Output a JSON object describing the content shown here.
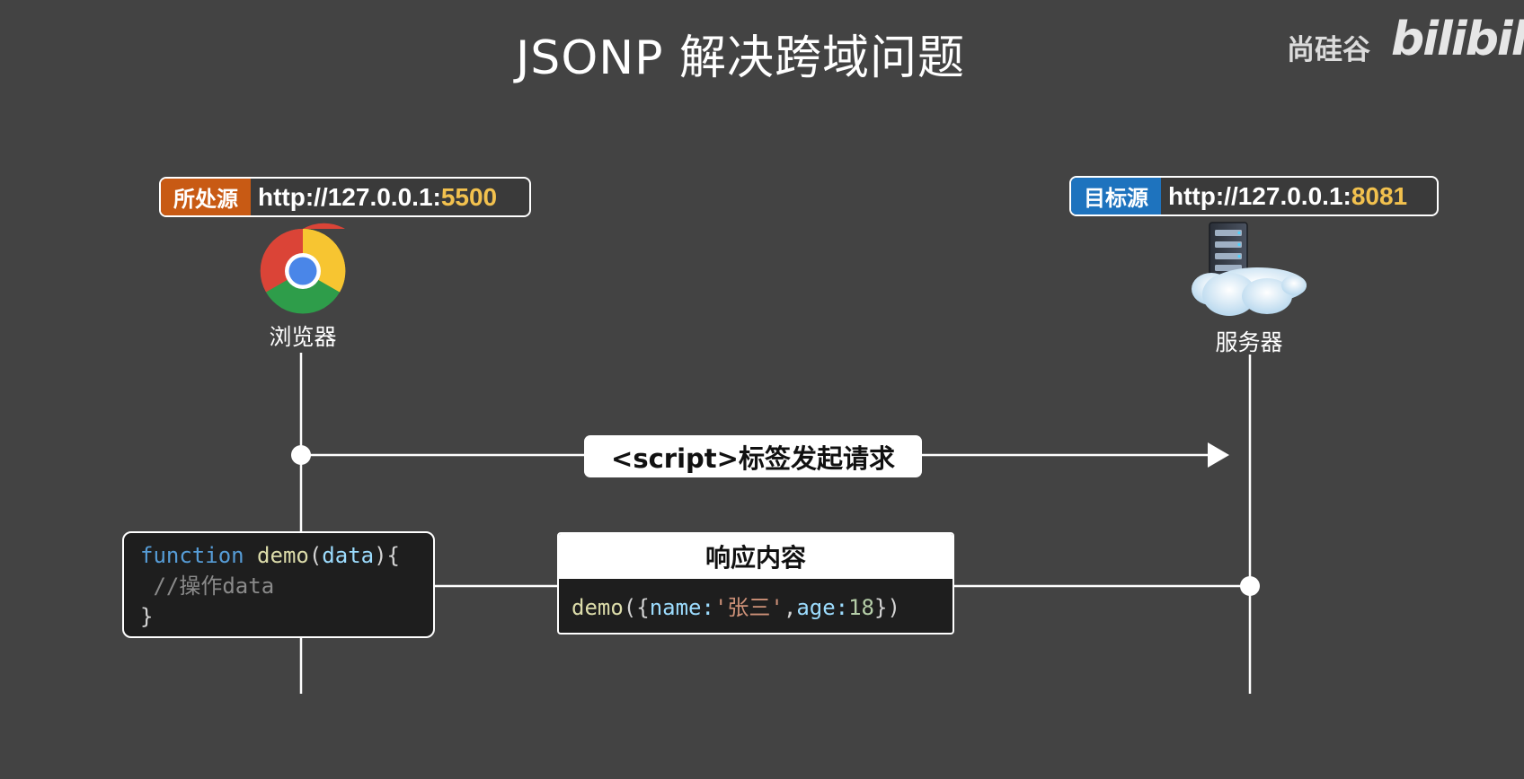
{
  "title": "JSONP 解决跨域问题",
  "watermark": {
    "brand": "尚硅谷",
    "site": "bilibili"
  },
  "left_origin": {
    "tag": "所处源",
    "url_prefix": "http://127.0.0.1:",
    "port": "5500",
    "tag_color": "#c85a14"
  },
  "right_origin": {
    "tag": "目标源",
    "url_prefix": "http://127.0.0.1:",
    "port": "8081",
    "tag_color": "#1e73be"
  },
  "browser": {
    "label": "浏览器",
    "icon": "chrome-icon"
  },
  "server": {
    "label": "服务器",
    "icon": "cloud-server-icon"
  },
  "request": {
    "label": "<script>标签发起请求"
  },
  "callback_code": {
    "keyword": "function",
    "name": "demo",
    "open_paren": "(",
    "param": "data",
    "close_sig": "){",
    "comment": "//操作data",
    "close_brace": "}"
  },
  "response": {
    "header": "响应内容",
    "fn": "demo",
    "open": "({",
    "key1": "name:",
    "val1": "'张三'",
    "comma": ",",
    "key2": "age:",
    "val2": "18",
    "close": "})"
  },
  "colors": {
    "background": "#434343",
    "port_highlight": "#f2c14e",
    "line": "#ffffff"
  }
}
